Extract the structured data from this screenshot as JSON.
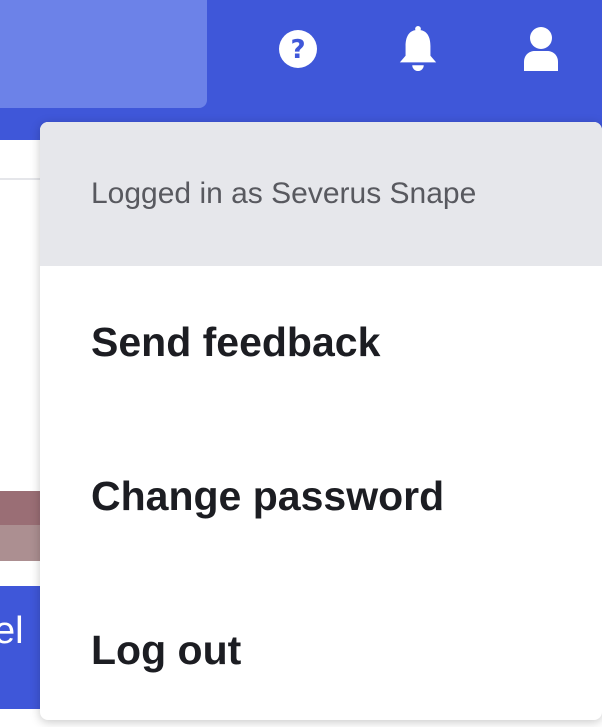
{
  "topbar": {
    "colors": {
      "bar": "#3f57d9",
      "search": "#6c82e8"
    },
    "icons": [
      "help-icon",
      "bell-icon",
      "user-icon"
    ]
  },
  "background": {
    "panel_text": "el"
  },
  "user_menu": {
    "header": "Logged in as Severus Snape",
    "items": [
      {
        "label": "Send feedback"
      },
      {
        "label": "Change password"
      },
      {
        "label": "Log out"
      }
    ]
  }
}
